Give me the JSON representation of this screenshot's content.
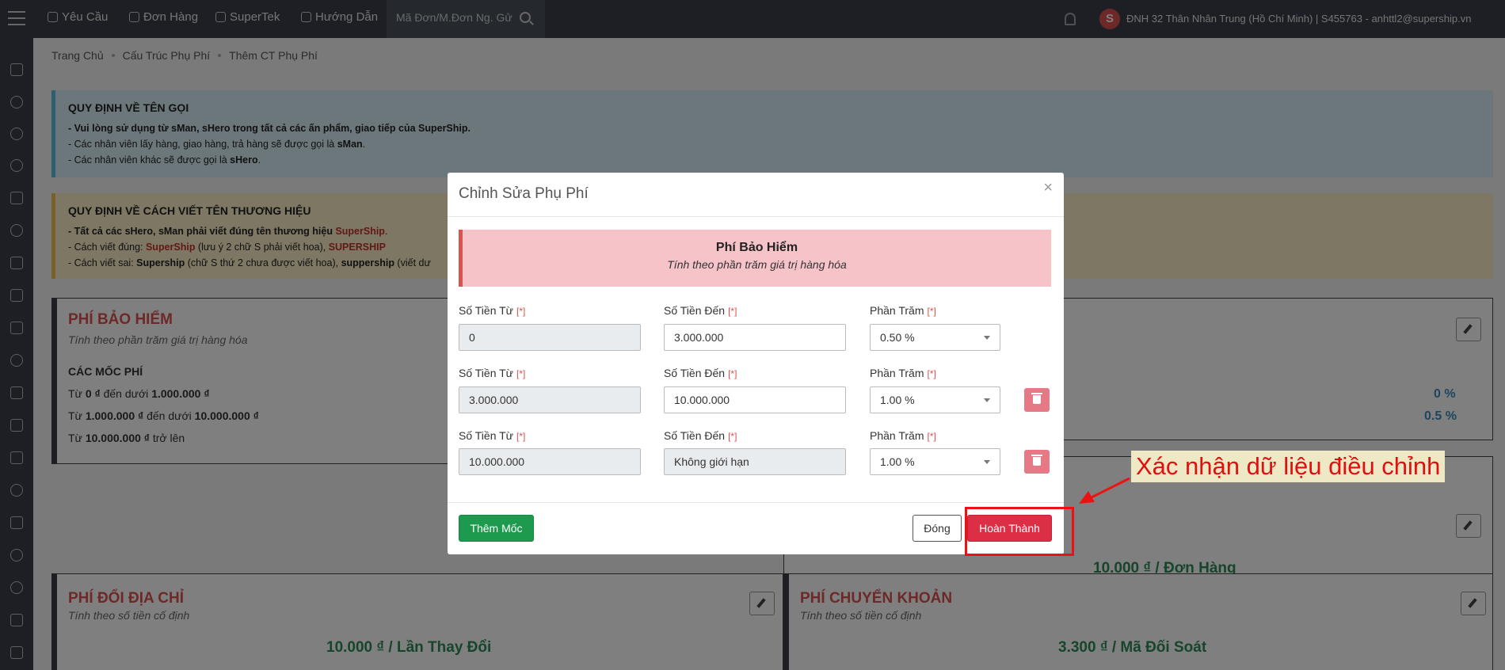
{
  "nav": {
    "items": [
      "Yêu Cầu",
      "Đơn Hàng",
      "SuperTek",
      "Hướng Dẫn"
    ],
    "search_placeholder": "Mã Đơn/M.Đơn Ng. Gử",
    "avatar_letter": "S",
    "user_info": "ĐNH 32 Thân Nhân Trung (Hồ Chí Minh) | S455763 - anhttl2@supership.vn"
  },
  "breadcrumb": [
    "Trang Chủ",
    "Cấu Trúc Phụ Phí",
    "Thêm CT Phụ Phí"
  ],
  "alert_info": {
    "title": "QUY ĐỊNH VỀ TÊN GỌI",
    "line1": "- Vui lòng sử dụng từ sMan, sHero trong tất cả các ấn phẩm, giao tiếp của SuperShip.",
    "line2_pre": "- Các nhân viên lấy hàng, giao hàng, trả hàng sẽ được gọi là ",
    "line2_bold": "sMan",
    "line3_pre": "- Các nhân viên khác sẽ được gọi là ",
    "line3_bold": "sHero"
  },
  "alert_warn": {
    "title": "QUY ĐỊNH VỀ CÁCH VIẾT TÊN THƯƠNG HIỆU",
    "line1_pre": "- Tất cả các sHero, sMan phải viết đúng tên thương hiệu ",
    "line1_brand": "SuperShip",
    "line2_pre": "- Cách viết đúng: ",
    "line2_a": "SuperShip",
    "line2_mid": " (lưu ý 2 chữ S phải viết hoa), ",
    "line2_b": "SUPERSHIP",
    "line3_pre": "- Cách viết sai: ",
    "line3_a": "Supership",
    "line3_mid": " (chữ S thứ 2 chưa được viết hoa), ",
    "line3_b": "suppership",
    "line3_post": " (viết dư"
  },
  "card_insurance": {
    "title": "PHÍ BẢO HIỂM",
    "subtitle": "Tính theo phần trăm giá trị hàng hóa",
    "tiers_label": "CÁC MỐC PHÍ",
    "tiers": [
      {
        "a": "Từ ",
        "b": "0 ₫",
        "c": " đến dưới ",
        "d": "1.000.000 ₫",
        "value": "0 %"
      },
      {
        "a": "Từ ",
        "b": "1.000.000 ₫",
        "c": " đến dưới ",
        "d": "10.000.000 ₫",
        "value": "0.5 %"
      },
      {
        "a": "Từ ",
        "b": "10.000.000 ₫",
        "c": " trở lên",
        "d": "",
        "value": ""
      }
    ]
  },
  "card_order_price": "10.000 ₫ / Đơn Hàng",
  "card_address": {
    "title": "PHÍ ĐỔI ĐỊA CHỈ",
    "subtitle": "Tính theo số tiền cố định",
    "price": "10.000 ₫ / Lần Thay Đổi"
  },
  "card_transfer": {
    "title": "PHÍ CHUYỂN KHOẢN",
    "subtitle": "Tính theo số tiền cố định",
    "price": "3.300 ₫ / Mã Đối Soát"
  },
  "modal": {
    "title": "Chỉnh Sửa Phụ Phí",
    "close": "×",
    "banner_title": "Phí Bảo Hiểm",
    "banner_subtitle": "Tính theo phần trăm giá trị hàng hóa",
    "label_from": "Số Tiền Từ",
    "label_to": "Số Tiền Đến",
    "label_percent": "Phần Trăm",
    "required_mark": "[*]",
    "rows": [
      {
        "from": "0",
        "to": "3.000.000",
        "percent": "0.50 %"
      },
      {
        "from": "3.000.000",
        "to": "10.000.000",
        "percent": "1.00 %"
      },
      {
        "from": "10.000.000",
        "to": "Không giới hạn",
        "percent": "1.00 %"
      }
    ],
    "add_button": "Thêm Mốc",
    "close_button": "Đóng",
    "done_button": "Hoàn Thành"
  },
  "annotation": {
    "text": "Xác nhận dữ liệu điều chỉnh",
    "color": "#ee1111"
  }
}
